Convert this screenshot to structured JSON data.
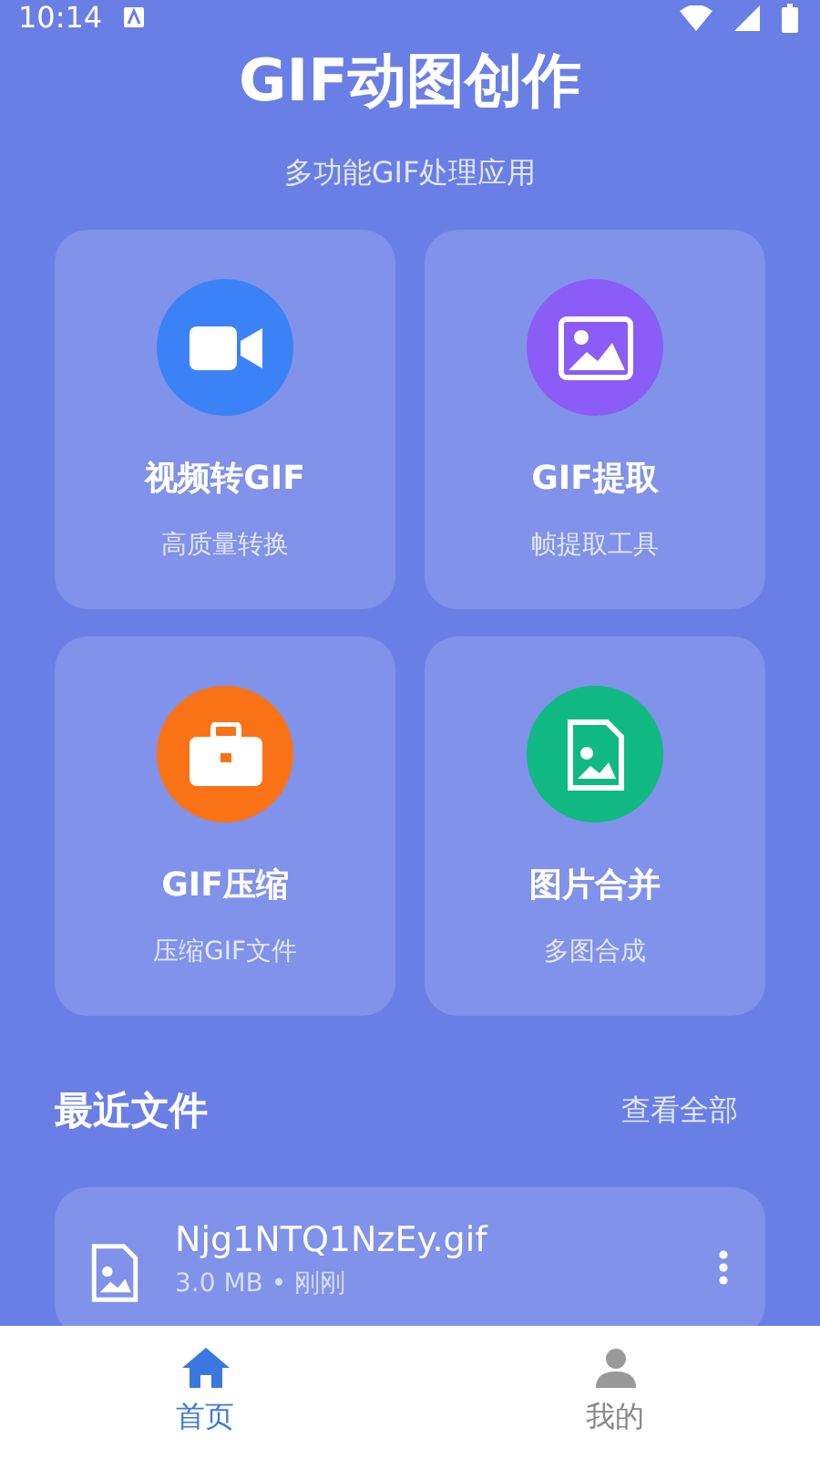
{
  "status_bar": {
    "time": "10:14"
  },
  "header": {
    "title": "GIF动图创作",
    "subtitle": "多功能GIF处理应用"
  },
  "tools": [
    {
      "kind": "video",
      "title": "视频转GIF",
      "subtitle": "高质量转换",
      "color": "#3b82f6"
    },
    {
      "kind": "image",
      "title": "GIF提取",
      "subtitle": "帧提取工具",
      "color": "#8b5cf6"
    },
    {
      "kind": "briefcase",
      "title": "GIF压缩",
      "subtitle": "压缩GIF文件",
      "color": "#f97316"
    },
    {
      "kind": "file",
      "title": "图片合并",
      "subtitle": "多图合成",
      "color": "#10b981"
    }
  ],
  "recent": {
    "title": "最近文件",
    "view_all": "查看全部",
    "files": [
      {
        "name": "Njg1NTQ1NzEy.gif",
        "meta": "3.0 MB • 刚刚"
      }
    ]
  },
  "bottom_nav": [
    {
      "kind": "home",
      "label": "首页",
      "selected": true
    },
    {
      "kind": "person",
      "label": "我的",
      "selected": false
    }
  ]
}
